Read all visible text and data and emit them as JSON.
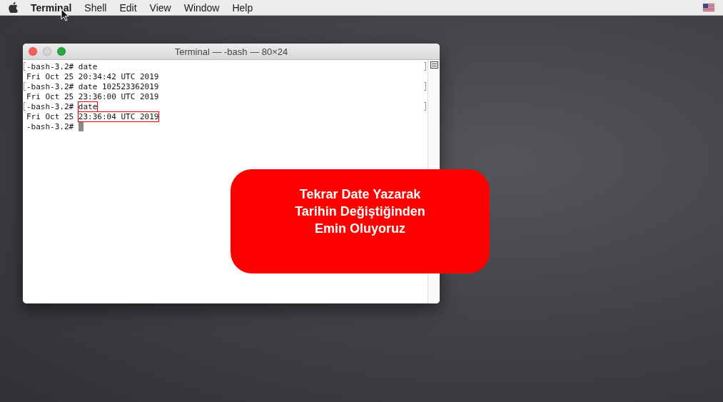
{
  "menu_bar": {
    "items": [
      {
        "kind": "app",
        "label": "Terminal"
      },
      {
        "kind": "menu",
        "label": "Shell"
      },
      {
        "kind": "menu",
        "label": "Edit"
      },
      {
        "kind": "menu",
        "label": "View"
      },
      {
        "kind": "menu",
        "label": "Window"
      },
      {
        "kind": "menu",
        "label": "Help"
      }
    ]
  },
  "window": {
    "title": "Terminal — -bash — 80×24",
    "lines": [
      {
        "marked": true,
        "cursor": false,
        "segments": [
          {
            "text": "-bash-3.2# date",
            "boxed": false
          }
        ]
      },
      {
        "marked": false,
        "cursor": false,
        "segments": [
          {
            "text": "Fri Oct 25 20:34:42 UTC 2019",
            "boxed": false
          }
        ]
      },
      {
        "marked": true,
        "cursor": false,
        "segments": [
          {
            "text": "-bash-3.2# date 102523362019",
            "boxed": false
          }
        ]
      },
      {
        "marked": false,
        "cursor": false,
        "segments": [
          {
            "text": "Fri Oct 25 23:36:00 UTC 2019",
            "boxed": false
          }
        ]
      },
      {
        "marked": true,
        "cursor": false,
        "segments": [
          {
            "text": "-bash-3.2# ",
            "boxed": false
          },
          {
            "text": "date",
            "boxed": true
          }
        ]
      },
      {
        "marked": false,
        "cursor": false,
        "segments": [
          {
            "text": "Fri Oct 25 ",
            "boxed": false
          },
          {
            "text": "23:36:04 UTC 2019",
            "boxed": true
          }
        ]
      },
      {
        "marked": false,
        "cursor": true,
        "segments": [
          {
            "text": "-bash-3.2# ",
            "boxed": false
          }
        ]
      }
    ]
  },
  "callout": {
    "lines": [
      "Tekrar Date Yazarak",
      "Tarihin Değiştiğinden",
      "Emin Oluyoruz"
    ]
  }
}
